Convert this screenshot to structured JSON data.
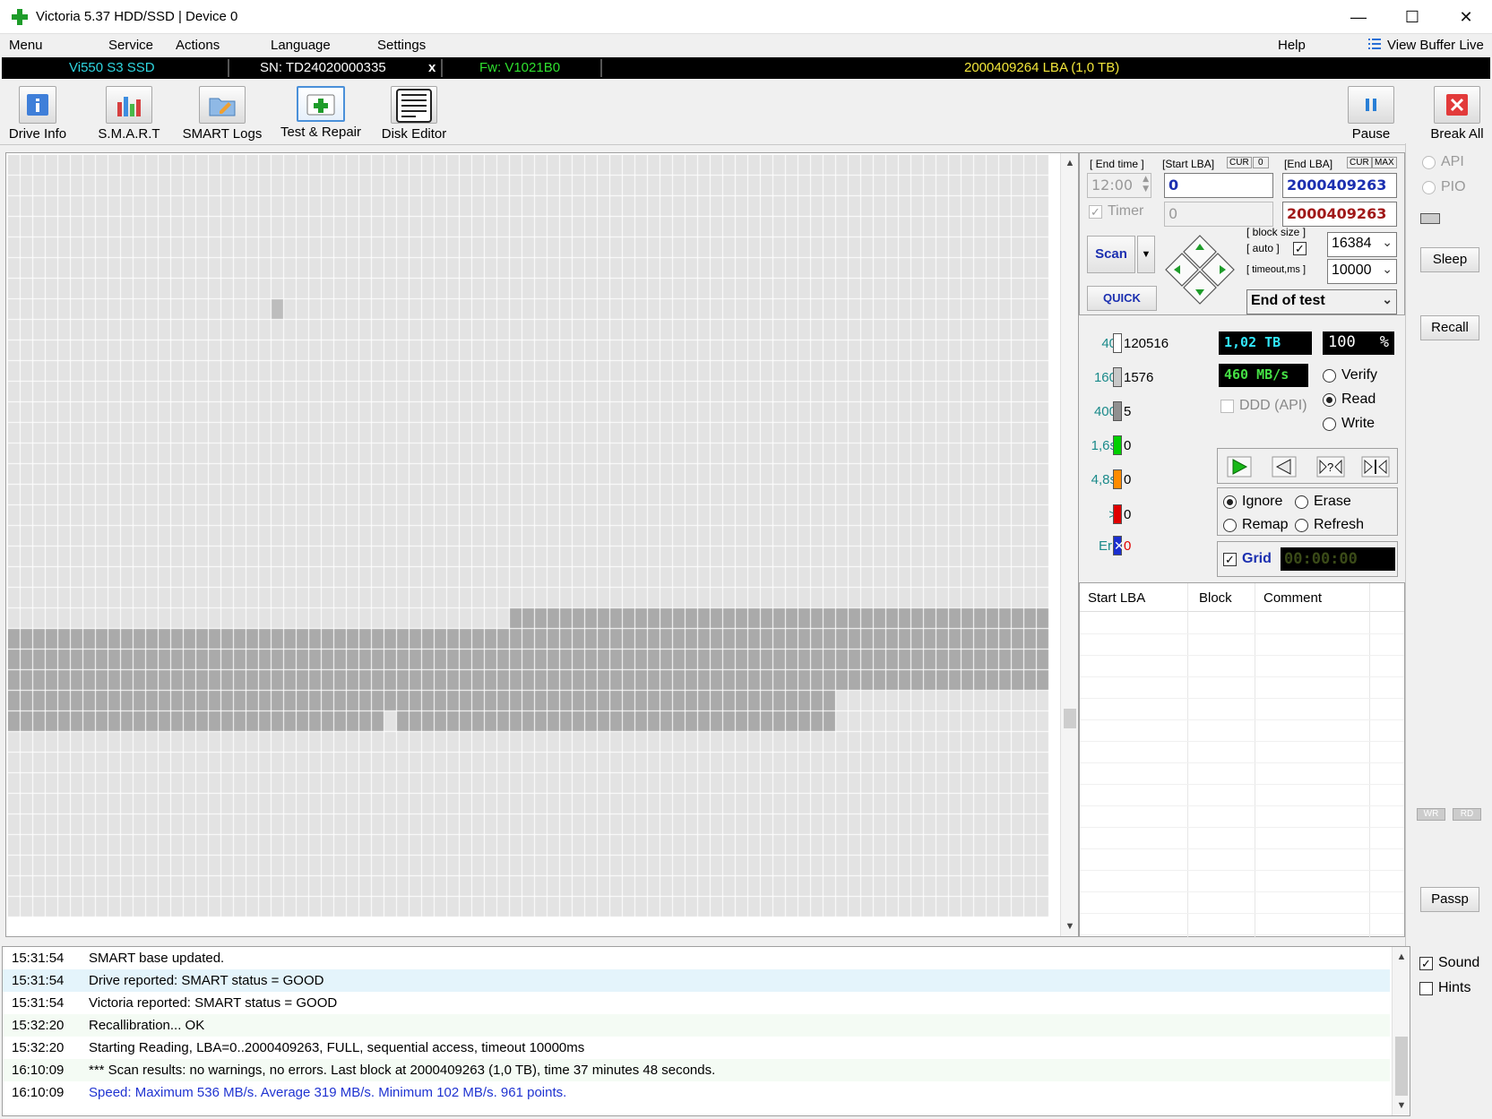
{
  "window": {
    "title": "Victoria 5.37 HDD/SSD | Device 0"
  },
  "menu": {
    "items": [
      "Menu",
      "Service",
      "Actions",
      "Language",
      "Settings"
    ],
    "help": "Help",
    "view_buffer": "View Buffer Live"
  },
  "drive_info": {
    "model": "Vi550 S3 SSD",
    "serial": "SN: TD24020000335",
    "close": "x",
    "firmware": "Fw: V1021B0",
    "capacity": "2000409264 LBA (1,0 TB)"
  },
  "toolbar": {
    "drive_info": "Drive Info",
    "smart": "S.M.A.R.T",
    "smart_logs": "SMART Logs",
    "test_repair": "Test & Repair",
    "disk_editor": "Disk Editor",
    "pause": "Pause",
    "break_all": "Break All"
  },
  "scan": {
    "end_time_label": "[ End time ]",
    "start_lba_label": "[Start LBA]",
    "cur": "CUR",
    "zero": "0",
    "end_lba_label": "[End LBA]",
    "max": "MAX",
    "end_time_value": "12:00",
    "start_lba_value": "0",
    "end_lba_value": "2000409263",
    "timer_label": "Timer",
    "timer_value": "0",
    "end_lba_value2": "2000409263",
    "scan_button": "Scan",
    "quick_button": "QUICK",
    "block_size_label": "[ block size ]",
    "auto_label": "[ auto ]",
    "timeout_label": "[ timeout,ms ]",
    "block_size_value": "16384",
    "timeout_value": "10000",
    "end_action": "End of test"
  },
  "stats": {
    "legend": [
      {
        "label": "40",
        "count": "120516",
        "color": "#ffffff"
      },
      {
        "label": "160",
        "count": "1576",
        "color": "#c8c8c8"
      },
      {
        "label": "400",
        "count": "5",
        "color": "#909090"
      },
      {
        "label": "1,6s",
        "count": "0",
        "color": "#00d000"
      },
      {
        "label": "4,8s",
        "count": "0",
        "color": "#ff8c00"
      },
      {
        "label": ">",
        "count": "0",
        "color": "#e00000"
      }
    ],
    "err_label": "Err",
    "err_count": "0",
    "progress_tb": "1,02 TB",
    "percent": "100",
    "percent_sign": "%",
    "speed": "460 MB/s",
    "ddd_label": "DDD (API)",
    "mode_verify": "Verify",
    "mode_read": "Read",
    "mode_write": "Write",
    "act_ignore": "Ignore",
    "act_erase": "Erase",
    "act_remap": "Remap",
    "act_refresh": "Refresh",
    "grid_label": "Grid",
    "timer_display": "00:00:00"
  },
  "table": {
    "columns": [
      "Start LBA",
      "Block",
      "Comment"
    ]
  },
  "sidebar": {
    "api": "API",
    "pio": "PIO",
    "sleep": "Sleep",
    "recall": "Recall",
    "wr": "WR",
    "rd": "RD",
    "passp": "Passp",
    "sound": "Sound",
    "hints": "Hints"
  },
  "log": [
    {
      "time": "15:31:54",
      "msg": "SMART base updated."
    },
    {
      "time": "15:31:54",
      "msg": "Drive reported: SMART status = GOOD"
    },
    {
      "time": "15:31:54",
      "msg": "Victoria reported: SMART status = GOOD"
    },
    {
      "time": "15:32:20",
      "msg": "Recallibration... OK"
    },
    {
      "time": "15:32:20",
      "msg": "Starting Reading, LBA=0..2000409263, FULL, sequential access, timeout 10000ms"
    },
    {
      "time": "16:10:09",
      "msg": "*** Scan results: no warnings, no errors. Last block at 2000409263 (1,0 TB), time 37 minutes 48 seconds."
    },
    {
      "time": "16:10:09",
      "msg": "Speed: Maximum 536 MB/s. Average 319 MB/s. Minimum 102 MB/s. 961 points."
    }
  ],
  "colors": {
    "cell_light": "#e3e3e3",
    "cell_dark": "#aaaaaa",
    "log_highlight": "#e4f4fb",
    "log_speed": "#1f33d1"
  }
}
